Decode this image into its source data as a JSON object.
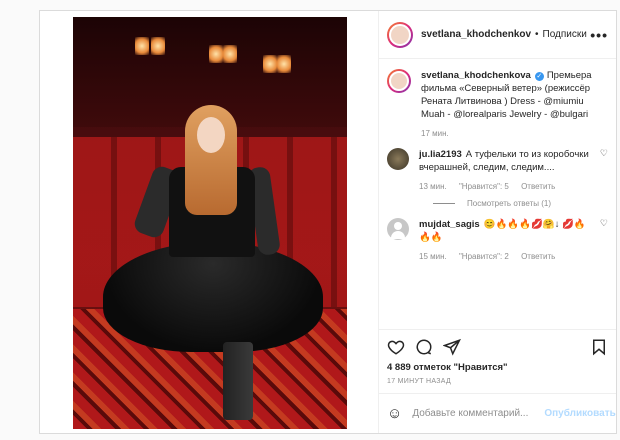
{
  "header": {
    "username": "svetlana_khodchenkov",
    "dot": "•",
    "follow_label": "Подписки",
    "more": "•••"
  },
  "caption": {
    "username": "svetlana_khodchenkova",
    "text": "Премьера фильма «Северный ветер» (режиссёр Рената Литвинова ) Dress - @miumiu Muah - @lorealparis Jewelry - @bulgari",
    "time": "17 мин."
  },
  "comments": [
    {
      "username": "ju.lia2193",
      "text": "А туфельки то из коробочки вчерашней, следим, следим....",
      "time": "13 мин.",
      "likes": "\"Нравится\": 5",
      "reply": "Ответить",
      "view_replies": "Посмотреть ответы (1)"
    },
    {
      "username": "mujdat_sagis",
      "text": "😊🔥🔥🔥💋🤗↓ 💋🔥🔥🔥",
      "time": "15 мин.",
      "likes": "\"Нравится\": 2",
      "reply": "Ответить"
    }
  ],
  "stats": {
    "likes": "4 889 отметок \"Нравится\"",
    "time": "17 МИНУТ НАЗАД"
  },
  "add_comment": {
    "emoji": "☺",
    "placeholder": "Добавьте комментарий...",
    "post_label": "Опубликовать"
  },
  "icons": [
    "heart-icon",
    "comment-icon",
    "share-icon",
    "bookmark-icon",
    "more-icon",
    "verified-icon",
    "emoji-icon"
  ]
}
